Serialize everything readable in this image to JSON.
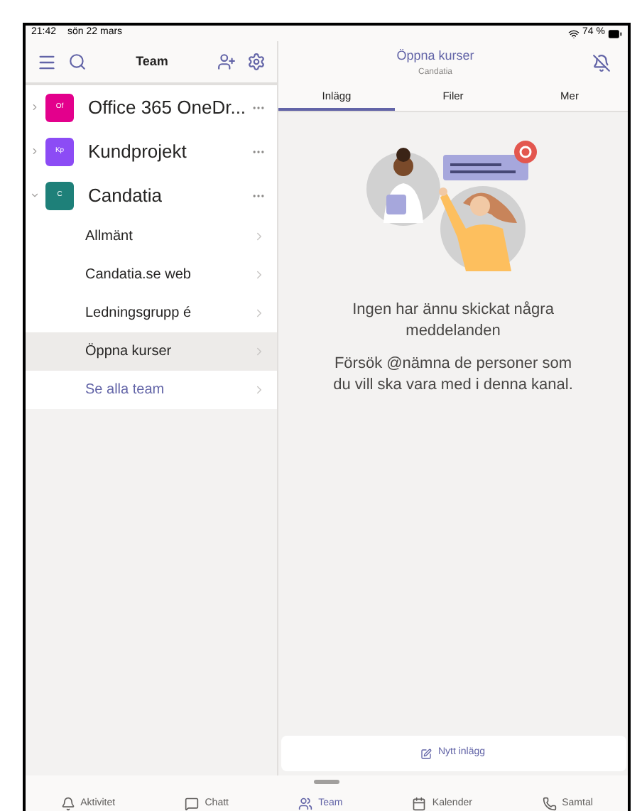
{
  "status_bar": {
    "time": "21:42",
    "date": "sön 22 mars",
    "battery": "74 %"
  },
  "sidebar": {
    "title": "Team",
    "teams": [
      {
        "initials": "Of",
        "name": "Office 365 OneDr...",
        "color": "#e3008c",
        "expanded": false
      },
      {
        "initials": "Kp",
        "name": "Kundprojekt",
        "color": "#8c4cf5",
        "expanded": false
      },
      {
        "initials": "C",
        "name": "Candatia",
        "color": "#1e8079",
        "expanded": true,
        "children": [
          {
            "name": "Allmänt",
            "selected": false
          },
          {
            "name": "Candatia.se web",
            "selected": false
          },
          {
            "name": "Ledningsgrupp é",
            "selected": false
          },
          {
            "name": "Öppna kurser",
            "selected": true
          }
        ]
      }
    ],
    "see_all": "Se alla team"
  },
  "channel": {
    "title": "Öppna kurser",
    "subtitle": "Candatia",
    "tabs": [
      {
        "label": "Inlägg",
        "selected": true
      },
      {
        "label": "Filer",
        "selected": false
      },
      {
        "label": "Mer",
        "selected": false
      }
    ],
    "empty_heading": "Ingen har ännu skickat några meddelanden",
    "empty_body": "Försök @nämna de personer som du vill ska vara med i denna kanal.",
    "compose_button": "Nytt inlägg"
  },
  "bottom_tabs": [
    {
      "kind": "activity",
      "label": "Aktivitet",
      "selected": false
    },
    {
      "kind": "chat",
      "label": "Chatt",
      "selected": false
    },
    {
      "kind": "teams",
      "label": "Team",
      "selected": true
    },
    {
      "kind": "calendar",
      "label": "Kalender",
      "selected": false
    },
    {
      "kind": "calls",
      "label": "Samtal",
      "selected": false
    }
  ]
}
